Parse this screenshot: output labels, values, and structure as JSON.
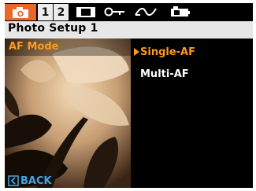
{
  "tabs": [
    {
      "icon": "camera-icon",
      "active": true
    },
    {
      "label": "1"
    },
    {
      "label": "2"
    },
    {
      "icon": "display-icon"
    },
    {
      "icon": "key-icon"
    },
    {
      "icon": "wave-icon"
    },
    {
      "icon": "camera-battery-icon"
    }
  ],
  "title": "Photo Setup 1",
  "menu": {
    "af_mode_label": "AF Mode",
    "options": [
      "Single-AF",
      "Multi-AF"
    ],
    "selected_index": 0
  },
  "back_label": "BACK",
  "colors": {
    "accent": "#e8682a",
    "highlight_text": "#ff9a1a",
    "back": "#3fa7e8"
  }
}
